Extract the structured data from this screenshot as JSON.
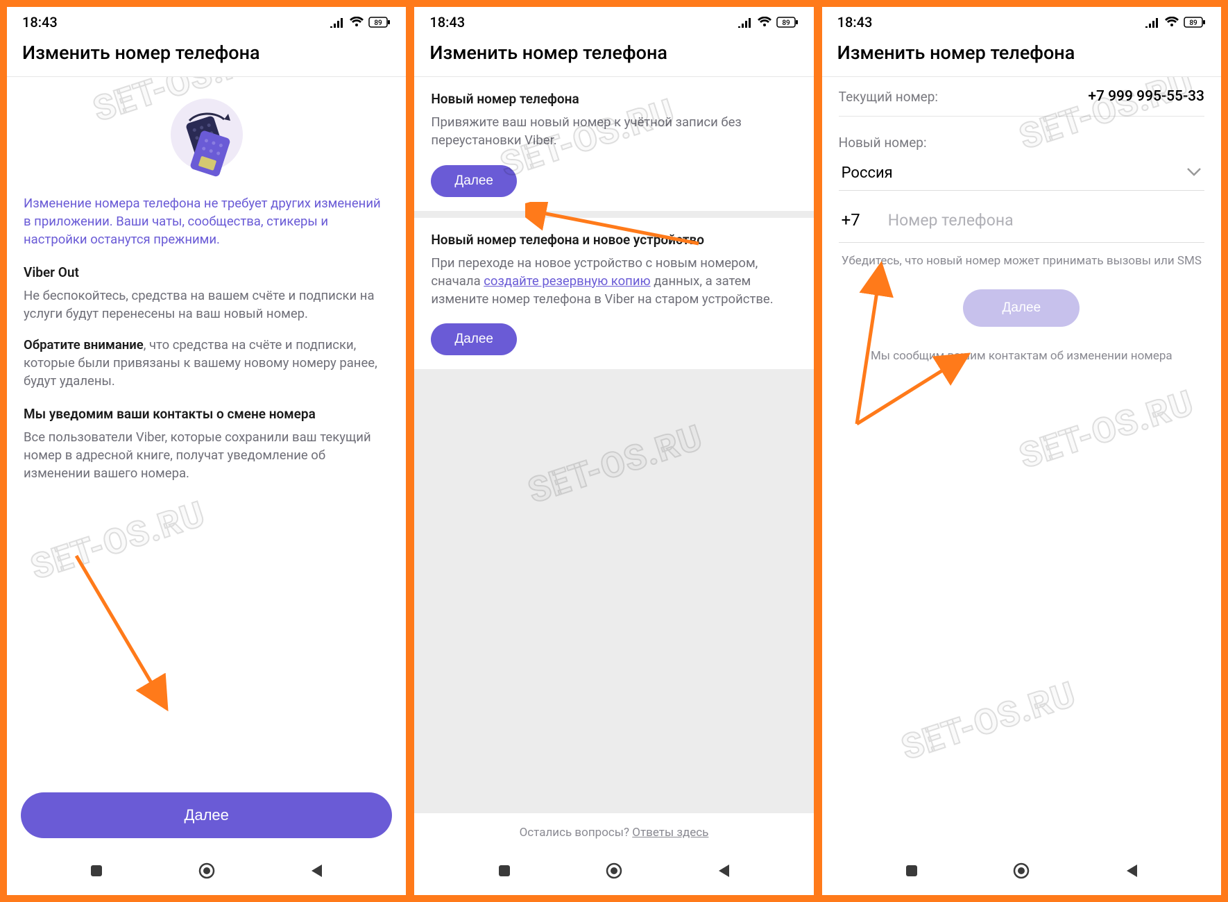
{
  "status": {
    "time": "18:43",
    "battery": "89"
  },
  "header": {
    "title": "Изменить номер телефона"
  },
  "screen1": {
    "intro": "Изменение номера телефона не требует других изменений в приложении. Ваши чаты, сообщества, стикеры и настройки останутся прежними.",
    "viber_out_title": "Viber Out",
    "viber_out_text": "Не беспокойтесь, средства на вашем счёте и подписки на услуги будут перенесены на ваш новый номер.",
    "note_bold": "Обратите внимание",
    "note_rest": ", что средства на счёте и подписки, которые были привязаны к вашему новому номеру ранее, будут удалены.",
    "notify_title": "Мы уведомим ваши контакты о смене номера",
    "notify_text": "Все пользователи Viber, которые сохранили ваш текущий номер в адресной книге, получат уведомление об изменении вашего номера.",
    "next": "Далее"
  },
  "screen2": {
    "s1_title": "Новый номер телефона",
    "s1_text": "Привяжите ваш новый номер к учётной записи без переустановки Viber.",
    "s2_title": "Новый номер телефона и новое устройство",
    "s2_pre": "При переходе на новое устройство с новым номером, сначала ",
    "s2_link": "создайте резервную копию",
    "s2_post": " данных, а затем измените номер телефона в Viber на старом устройстве.",
    "next": "Далее",
    "faq_pre": "Остались вопросы? ",
    "faq_link": "Ответы здесь"
  },
  "screen3": {
    "current_label": "Текущий номер:",
    "current_value": "+7 999 995-55-33",
    "new_label": "Новый номер:",
    "country": "Россия",
    "code": "+7",
    "placeholder": "Номер телефона",
    "hint": "Убедитесь, что новый номер может принимать вызовы или SMS",
    "next": "Далее",
    "notify": "Мы сообщим вашим контактам об изменении номера"
  }
}
